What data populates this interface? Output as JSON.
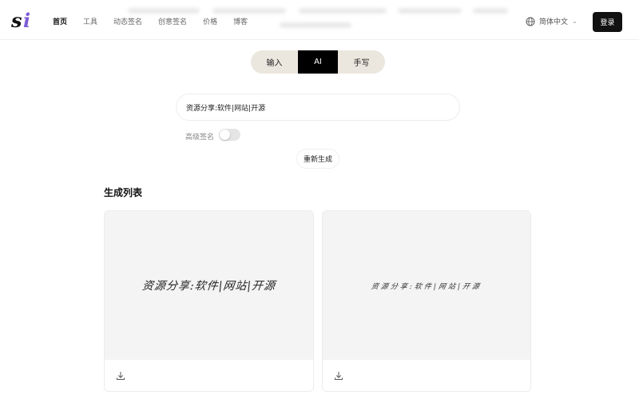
{
  "header": {
    "logo_text": "si",
    "nav": [
      {
        "label": "首页",
        "active": true
      },
      {
        "label": "工具",
        "active": false
      },
      {
        "label": "动态签名",
        "active": false
      },
      {
        "label": "创意签名",
        "active": false
      },
      {
        "label": "价格",
        "active": false
      },
      {
        "label": "博客",
        "active": false
      }
    ],
    "language": {
      "label": "简体中文",
      "icon": "globe-icon"
    },
    "login_label": "登录"
  },
  "mode_tabs": [
    {
      "label": "输入",
      "selected": false
    },
    {
      "label": "AI",
      "selected": true
    },
    {
      "label": "手写",
      "selected": false
    }
  ],
  "signature_input": {
    "value": "资源分享:软件|网站|开源"
  },
  "advanced": {
    "label": "高级签名",
    "enabled": false
  },
  "regenerate_label": "重新生成",
  "results": {
    "title": "生成列表",
    "items": [
      {
        "signature": "资源分享:软件|网站|开源",
        "download_icon": "download-icon"
      },
      {
        "signature": "资源分享:软件|网站|开源",
        "download_icon": "download-icon"
      }
    ]
  },
  "colors": {
    "logo_accent": "#7c5cd6",
    "tabs_bg": "#ebe7df",
    "selected_tab": "#000000",
    "button_dark": "#111111"
  }
}
